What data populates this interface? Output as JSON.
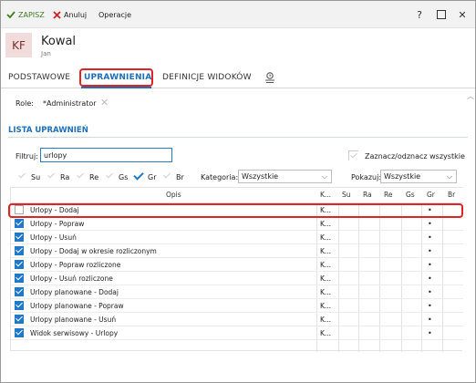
{
  "toolbar": {
    "save_label": "ZAPISZ",
    "cancel_label": "Anuluj",
    "operations_label": "Operacje"
  },
  "window_controls": {
    "help": "?",
    "close": "✕"
  },
  "record": {
    "initials": "KF",
    "name": "Kowal",
    "subname": "Jan"
  },
  "tabs": [
    {
      "label": "PODSTAWOWE",
      "active": false
    },
    {
      "label": "UPRAWNIENIA",
      "active": true
    },
    {
      "label": "DEFINICJE WIDOKÓW",
      "active": false
    }
  ],
  "role": {
    "label": "Role:",
    "value": "*Administrator"
  },
  "section_title": "LISTA UPRAWNIEŃ",
  "filter": {
    "label": "Filtruj:",
    "value": "urlopy"
  },
  "select_all_label": "Zaznacz/odznacz wszystkie",
  "column_toggles": [
    {
      "label": "Su",
      "checked": false
    },
    {
      "label": "Ra",
      "checked": false
    },
    {
      "label": "Re",
      "checked": false
    },
    {
      "label": "Gs",
      "checked": false
    },
    {
      "label": "Gr",
      "checked": true
    },
    {
      "label": "Br",
      "checked": false
    }
  ],
  "category": {
    "label": "Kategoria:",
    "value": "Wszystkie"
  },
  "show": {
    "label": "Pokazuj:",
    "value": "Wszystkie"
  },
  "grid": {
    "headers": {
      "opis": "Opis",
      "k": "K...",
      "su": "Su",
      "ra": "Ra",
      "re": "Re",
      "gs": "Gs",
      "gr": "Gr",
      "br": "Br"
    },
    "rows": [
      {
        "checked": false,
        "name": "Urlopy - Dodaj",
        "k": "K...",
        "gr": "•"
      },
      {
        "checked": true,
        "name": "Urlopy - Popraw",
        "k": "K...",
        "gr": "•"
      },
      {
        "checked": true,
        "name": "Urlopy - Usuń",
        "k": "K...",
        "gr": "•"
      },
      {
        "checked": true,
        "name": "Urlopy - Dodaj w okresie rozliczonym",
        "k": "K...",
        "gr": "•"
      },
      {
        "checked": true,
        "name": "Urlopy - Popraw rozliczone",
        "k": "K...",
        "gr": "•"
      },
      {
        "checked": true,
        "name": "Urlopy - Usuń rozliczone",
        "k": "K...",
        "gr": "•"
      },
      {
        "checked": true,
        "name": "Urlopy planowane - Dodaj",
        "k": "K...",
        "gr": "•"
      },
      {
        "checked": true,
        "name": "Urlopy planowane - Popraw",
        "k": "K...",
        "gr": "•"
      },
      {
        "checked": true,
        "name": "Urlopy planowane - Usuń",
        "k": "K...",
        "gr": "•"
      },
      {
        "checked": true,
        "name": "Widok serwisowy - Urlopy",
        "k": "K...",
        "gr": "•"
      }
    ]
  },
  "colors": {
    "accent": "#1d6fb8",
    "checkbox": "#1f78c8",
    "highlight": "#e02424",
    "save_green": "#3e7f1f",
    "avatar_bg": "#f1dbdb"
  }
}
